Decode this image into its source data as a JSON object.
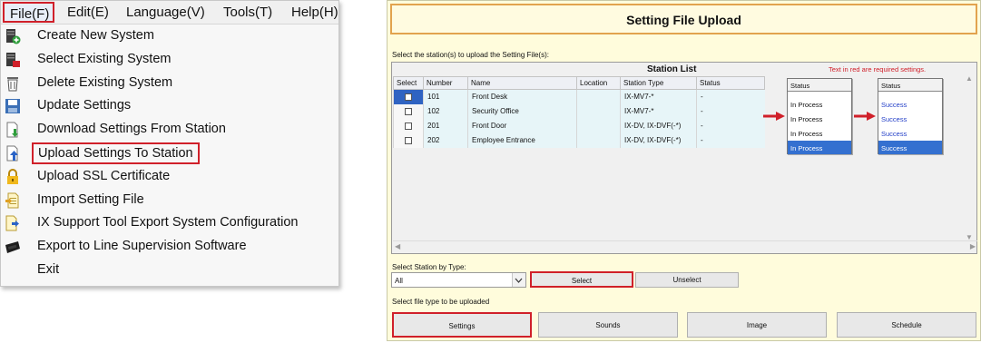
{
  "menubar": {
    "items": [
      "File(F)",
      "Edit(E)",
      "Language(V)",
      "Tools(T)",
      "Help(H)"
    ]
  },
  "file_menu": {
    "items": [
      {
        "label": "Create New System",
        "icon": "new-system-icon"
      },
      {
        "label": "Select Existing System",
        "icon": "select-system-icon"
      },
      {
        "label": "Delete Existing System",
        "icon": "trash-icon"
      },
      {
        "label": "Update Settings",
        "icon": "save-icon"
      },
      {
        "label": "Download Settings From Station",
        "icon": "download-icon"
      },
      {
        "label": "Upload Settings To Station",
        "icon": "upload-icon"
      },
      {
        "label": "Upload SSL Certificate",
        "icon": "lock-icon"
      },
      {
        "label": "Import Setting File",
        "icon": "import-icon"
      },
      {
        "label": "IX Support Tool Export System Configuration",
        "icon": "export-icon"
      },
      {
        "label": "Export to Line Supervision Software",
        "icon": "export-software-icon"
      },
      {
        "label": "Exit",
        "icon": ""
      }
    ],
    "highlighted": "Upload Settings To Station"
  },
  "dialog": {
    "title": "Setting File Upload",
    "select_stations_label": "Select the station(s) to upload the Setting File(s):",
    "station_list": {
      "title": "Station List",
      "required_note": "Text in red are required settings.",
      "columns": [
        "Select",
        "Number",
        "Name",
        "Location",
        "Station Type",
        "Status"
      ],
      "rows": [
        {
          "number": "101",
          "name": "Front Desk",
          "location": "",
          "station_type": "IX-MV7-*",
          "status": "-"
        },
        {
          "number": "102",
          "name": "Security Office",
          "location": "",
          "station_type": "IX-MV7-*",
          "status": "-"
        },
        {
          "number": "201",
          "name": "Front Door",
          "location": "",
          "station_type": "IX-DV, IX-DVF(-*)",
          "status": "-"
        },
        {
          "number": "202",
          "name": "Employee Entrance",
          "location": "",
          "station_type": "IX-DV, IX-DVF(-*)",
          "status": "-"
        }
      ]
    },
    "status_in_process": {
      "header": "Status",
      "rows": [
        "In Process",
        "In Process",
        "In Process",
        "In Process"
      ]
    },
    "status_success": {
      "header": "Status",
      "rows": [
        "Success",
        "Success",
        "Success",
        "Success"
      ]
    },
    "select_by_type_label": "Select Station by Type:",
    "type_value": "All",
    "select_button": "Select",
    "unselect_button": "Unselect",
    "file_type_label": "Select file type to be uploaded",
    "file_type_buttons": [
      "Settings",
      "Sounds",
      "Image",
      "Schedule"
    ]
  },
  "colors": {
    "highlight_red": "#d0202a",
    "dialog_background": "#fffcdc",
    "selection_blue": "#3470d0",
    "success_text": "#2540c8"
  }
}
